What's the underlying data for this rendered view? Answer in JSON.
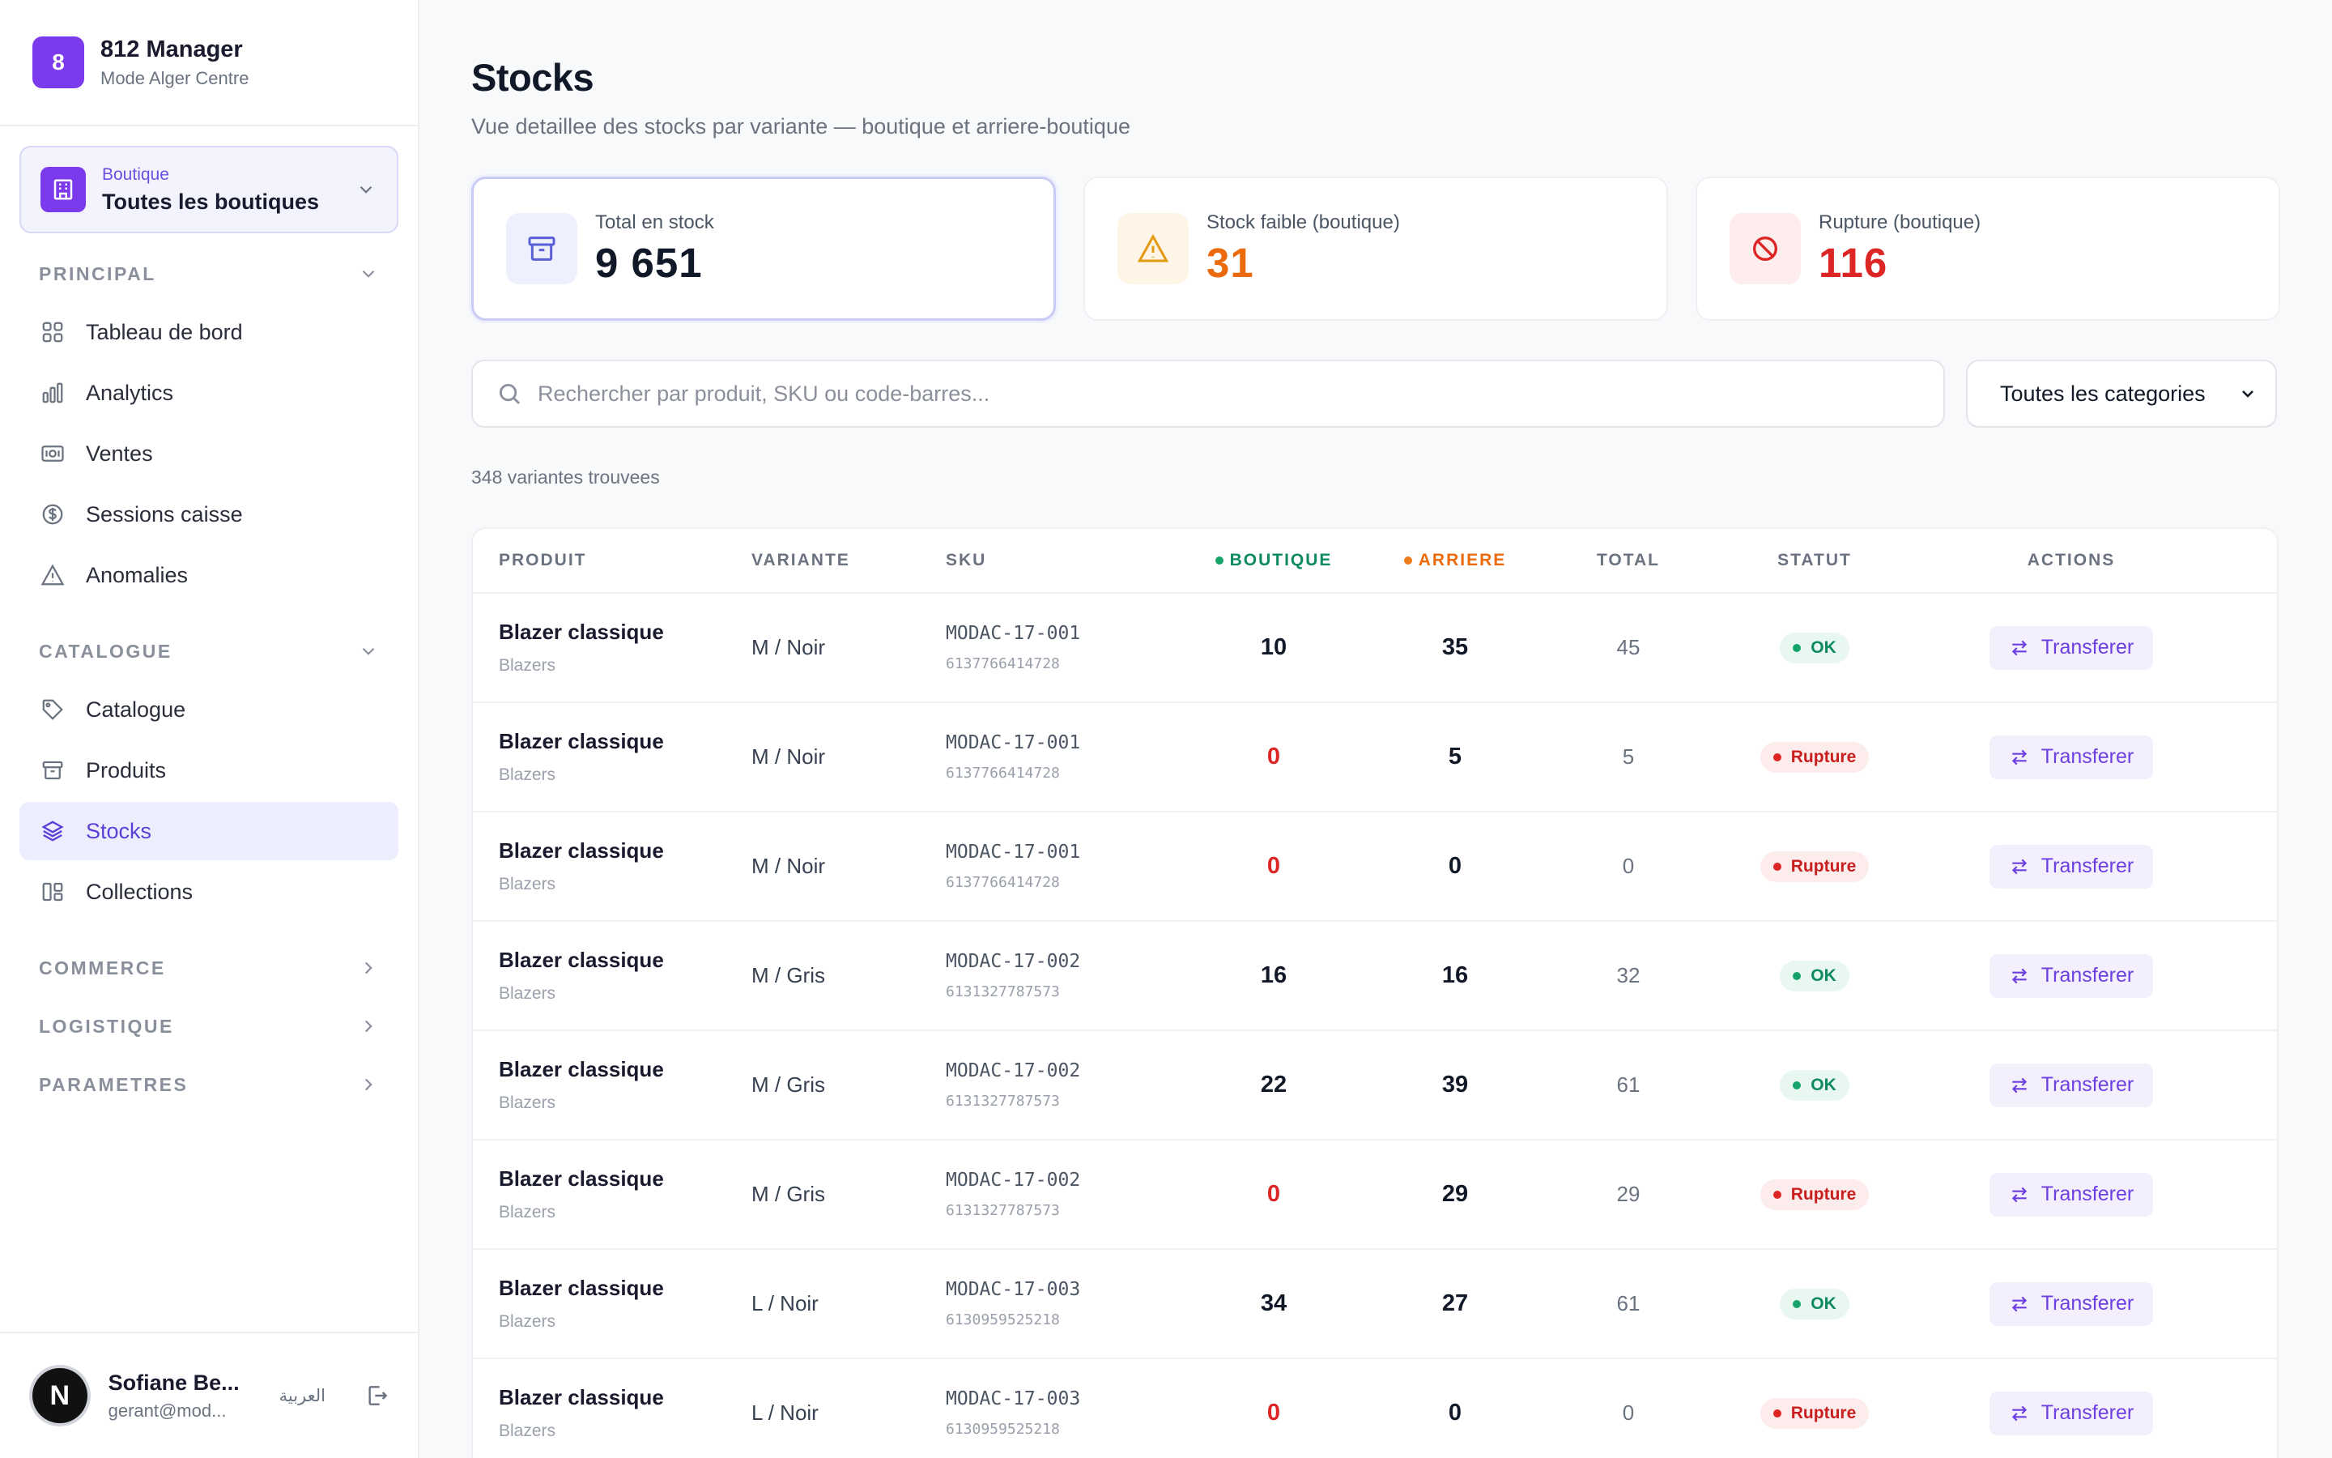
{
  "brand": {
    "logo_letter": "8",
    "name": "812 Manager",
    "subtitle": "Mode Alger Centre"
  },
  "store": {
    "label": "Boutique",
    "value": "Toutes les boutiques"
  },
  "nav": {
    "principal": {
      "title": "PRINCIPAL",
      "items": [
        {
          "label": "Tableau de bord",
          "icon": "grid-icon"
        },
        {
          "label": "Analytics",
          "icon": "bar-chart-icon"
        },
        {
          "label": "Ventes",
          "icon": "banknote-icon"
        },
        {
          "label": "Sessions caisse",
          "icon": "dollar-circle-icon"
        },
        {
          "label": "Anomalies",
          "icon": "warning-icon"
        }
      ]
    },
    "catalogue": {
      "title": "CATALOGUE",
      "items": [
        {
          "label": "Catalogue",
          "icon": "tag-icon"
        },
        {
          "label": "Produits",
          "icon": "archive-icon"
        },
        {
          "label": "Stocks",
          "icon": "layers-icon",
          "active": true
        },
        {
          "label": "Collections",
          "icon": "collections-icon"
        }
      ]
    },
    "commerce": {
      "title": "COMMERCE"
    },
    "logistique": {
      "title": "LOGISTIQUE"
    },
    "parametres": {
      "title": "PARAMETRES"
    }
  },
  "user": {
    "avatar_letter": "N",
    "name": "Sofiane Be...",
    "email": "gerant@mod...",
    "lang": "العربية"
  },
  "page": {
    "title": "Stocks",
    "subtitle": "Vue detaillee des stocks par variante — boutique et arriere-boutique"
  },
  "stats": [
    {
      "label": "Total en stock",
      "value": "9 651",
      "color": "#111827",
      "icon": "archive-icon"
    },
    {
      "label": "Stock faible (boutique)",
      "value": "31",
      "color": "#ea6a0c",
      "icon": "warning-icon"
    },
    {
      "label": "Rupture (boutique)",
      "value": "116",
      "color": "#dc2626",
      "icon": "ban-icon"
    }
  ],
  "search": {
    "placeholder": "Rechercher par produit, SKU ou code-barres...",
    "value": ""
  },
  "category_filter": {
    "selected": "Toutes les categories"
  },
  "result_count": "348 variantes trouvees",
  "table": {
    "headers": {
      "produit": "PRODUIT",
      "variante": "VARIANTE",
      "sku": "SKU",
      "boutique": "BOUTIQUE",
      "arriere": "ARRIERE",
      "total": "TOTAL",
      "statut": "STATUT",
      "actions": "ACTIONS"
    },
    "action_label": "Transferer",
    "rows": [
      {
        "name": "Blazer classique",
        "cat": "Blazers",
        "variant": "M / Noir",
        "sku": "MODAC-17-001",
        "barcode": "6137766414728",
        "boutique": "10",
        "arriere": "35",
        "total": "45",
        "status": "OK",
        "status_type": "ok"
      },
      {
        "name": "Blazer classique",
        "cat": "Blazers",
        "variant": "M / Noir",
        "sku": "MODAC-17-001",
        "barcode": "6137766414728",
        "boutique": "0",
        "arriere": "5",
        "total": "5",
        "status": "Rupture",
        "status_type": "rupture"
      },
      {
        "name": "Blazer classique",
        "cat": "Blazers",
        "variant": "M / Noir",
        "sku": "MODAC-17-001",
        "barcode": "6137766414728",
        "boutique": "0",
        "arriere": "0",
        "total": "0",
        "status": "Rupture",
        "status_type": "rupture"
      },
      {
        "name": "Blazer classique",
        "cat": "Blazers",
        "variant": "M / Gris",
        "sku": "MODAC-17-002",
        "barcode": "6131327787573",
        "boutique": "16",
        "arriere": "16",
        "total": "32",
        "status": "OK",
        "status_type": "ok"
      },
      {
        "name": "Blazer classique",
        "cat": "Blazers",
        "variant": "M / Gris",
        "sku": "MODAC-17-002",
        "barcode": "6131327787573",
        "boutique": "22",
        "arriere": "39",
        "total": "61",
        "status": "OK",
        "status_type": "ok"
      },
      {
        "name": "Blazer classique",
        "cat": "Blazers",
        "variant": "M / Gris",
        "sku": "MODAC-17-002",
        "barcode": "6131327787573",
        "boutique": "0",
        "arriere": "29",
        "total": "29",
        "status": "Rupture",
        "status_type": "rupture"
      },
      {
        "name": "Blazer classique",
        "cat": "Blazers",
        "variant": "L / Noir",
        "sku": "MODAC-17-003",
        "barcode": "6130959525218",
        "boutique": "34",
        "arriere": "27",
        "total": "61",
        "status": "OK",
        "status_type": "ok"
      },
      {
        "name": "Blazer classique",
        "cat": "Blazers",
        "variant": "L / Noir",
        "sku": "MODAC-17-003",
        "barcode": "6130959525218",
        "boutique": "0",
        "arriere": "0",
        "total": "0",
        "status": "Rupture",
        "status_type": "rupture"
      }
    ]
  },
  "colors": {
    "accent": "#7c3aed",
    "ok": "#0f8a5f",
    "rupture": "#dc2626",
    "warning": "#ea6a0c"
  }
}
